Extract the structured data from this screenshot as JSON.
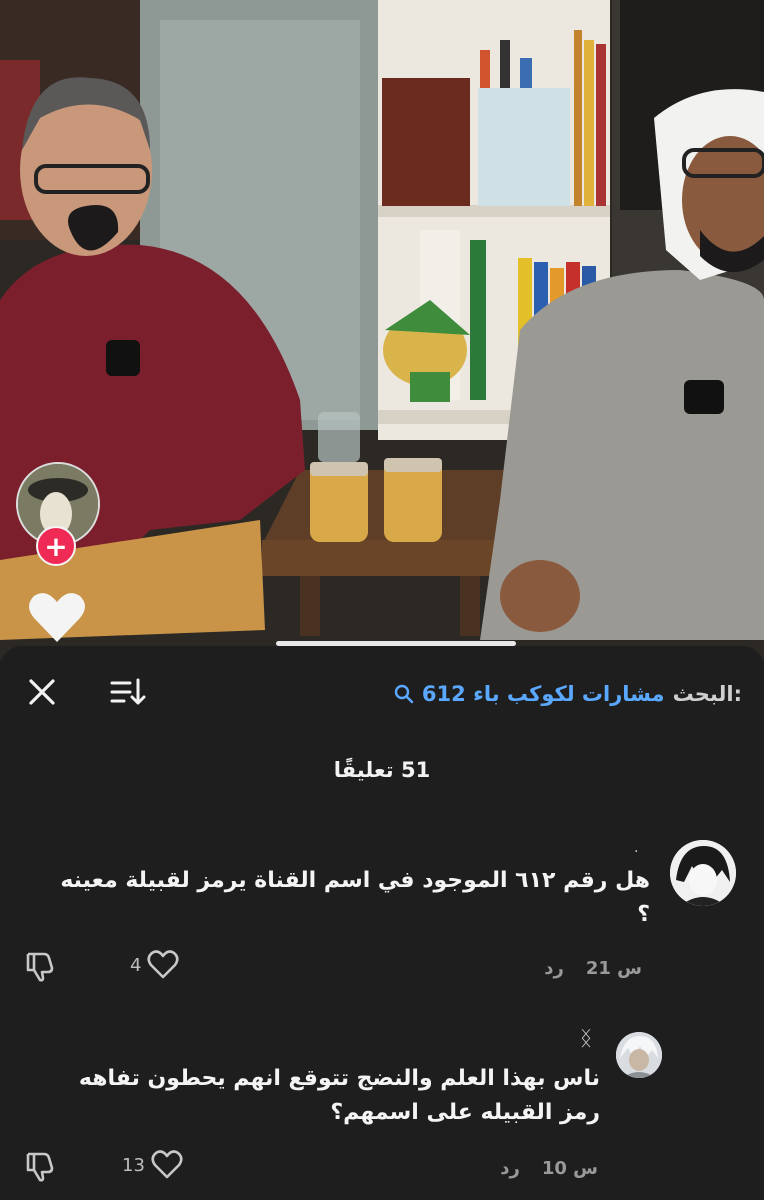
{
  "search": {
    "prefix": "البحث:",
    "term": "مشارات لكوكب باء 612"
  },
  "comments_count": "51 تعليقًا",
  "comments": [
    {
      "username": ".",
      "text": "هل رقم ٦١٢ الموجود في اسم القناة يرمز لقبيلة معينه ؟",
      "time": "21 س",
      "reply_label": "رد",
      "likes": "4"
    },
    {
      "username": "ᛝ",
      "text": "ناس بهذا العلم والنضج تتوقع انهم يحطون تفاهه رمز القبيله على اسمهم؟",
      "time": "10 س",
      "reply_label": "رد",
      "likes": "13"
    }
  ],
  "icons": {
    "close": "close-icon",
    "sort": "sort-icon",
    "search": "search-icon",
    "heart": "heart-icon",
    "dislike": "thumbs-down-icon",
    "follow": "plus-icon"
  },
  "colors": {
    "sheet_bg": "#1e1e1e",
    "accent_link": "#5aa8ff",
    "follow_red": "#ef2b55"
  },
  "follow_symbol": "+"
}
